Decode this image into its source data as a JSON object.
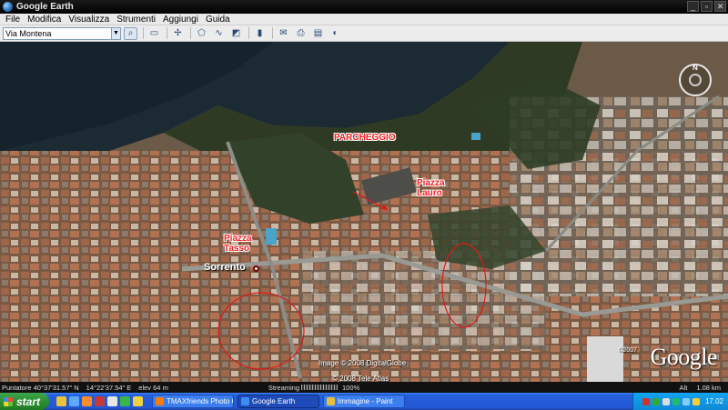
{
  "window": {
    "title": "Google Earth"
  },
  "menu": [
    "File",
    "Modifica",
    "Visualizza",
    "Strumenti",
    "Aggiungi",
    "Guida"
  ],
  "toolbar": {
    "search_value": "Via Montena"
  },
  "map": {
    "labels": {
      "parcheggio": "PARCHEGGIO",
      "piazza_lauro": "Piazza\nLauro",
      "piazza_tasso": "Piazza\nTasso",
      "sorrento": "Sorrento"
    },
    "credits": {
      "image": "Image © 2008 DigitalGlobe",
      "tele_atlas": "© 2008 Tele Atlas",
      "copyright": "©2007",
      "logo": "Google"
    },
    "compass_north": "N"
  },
  "status": {
    "pointer": "Puntatore  40°37'31.57\" N",
    "lon": "14°22'37.54\" E",
    "elev": "elev   64 m",
    "streaming_label": "Streaming",
    "streaming_pct": "100%",
    "alt": "Alt",
    "alt_value": "1.08 km"
  },
  "taskbar": {
    "start": "start",
    "tasks": [
      "TMAXfriends Photo G...",
      "Google Earth",
      "Immagine - Paint"
    ],
    "clock": "17.02"
  }
}
